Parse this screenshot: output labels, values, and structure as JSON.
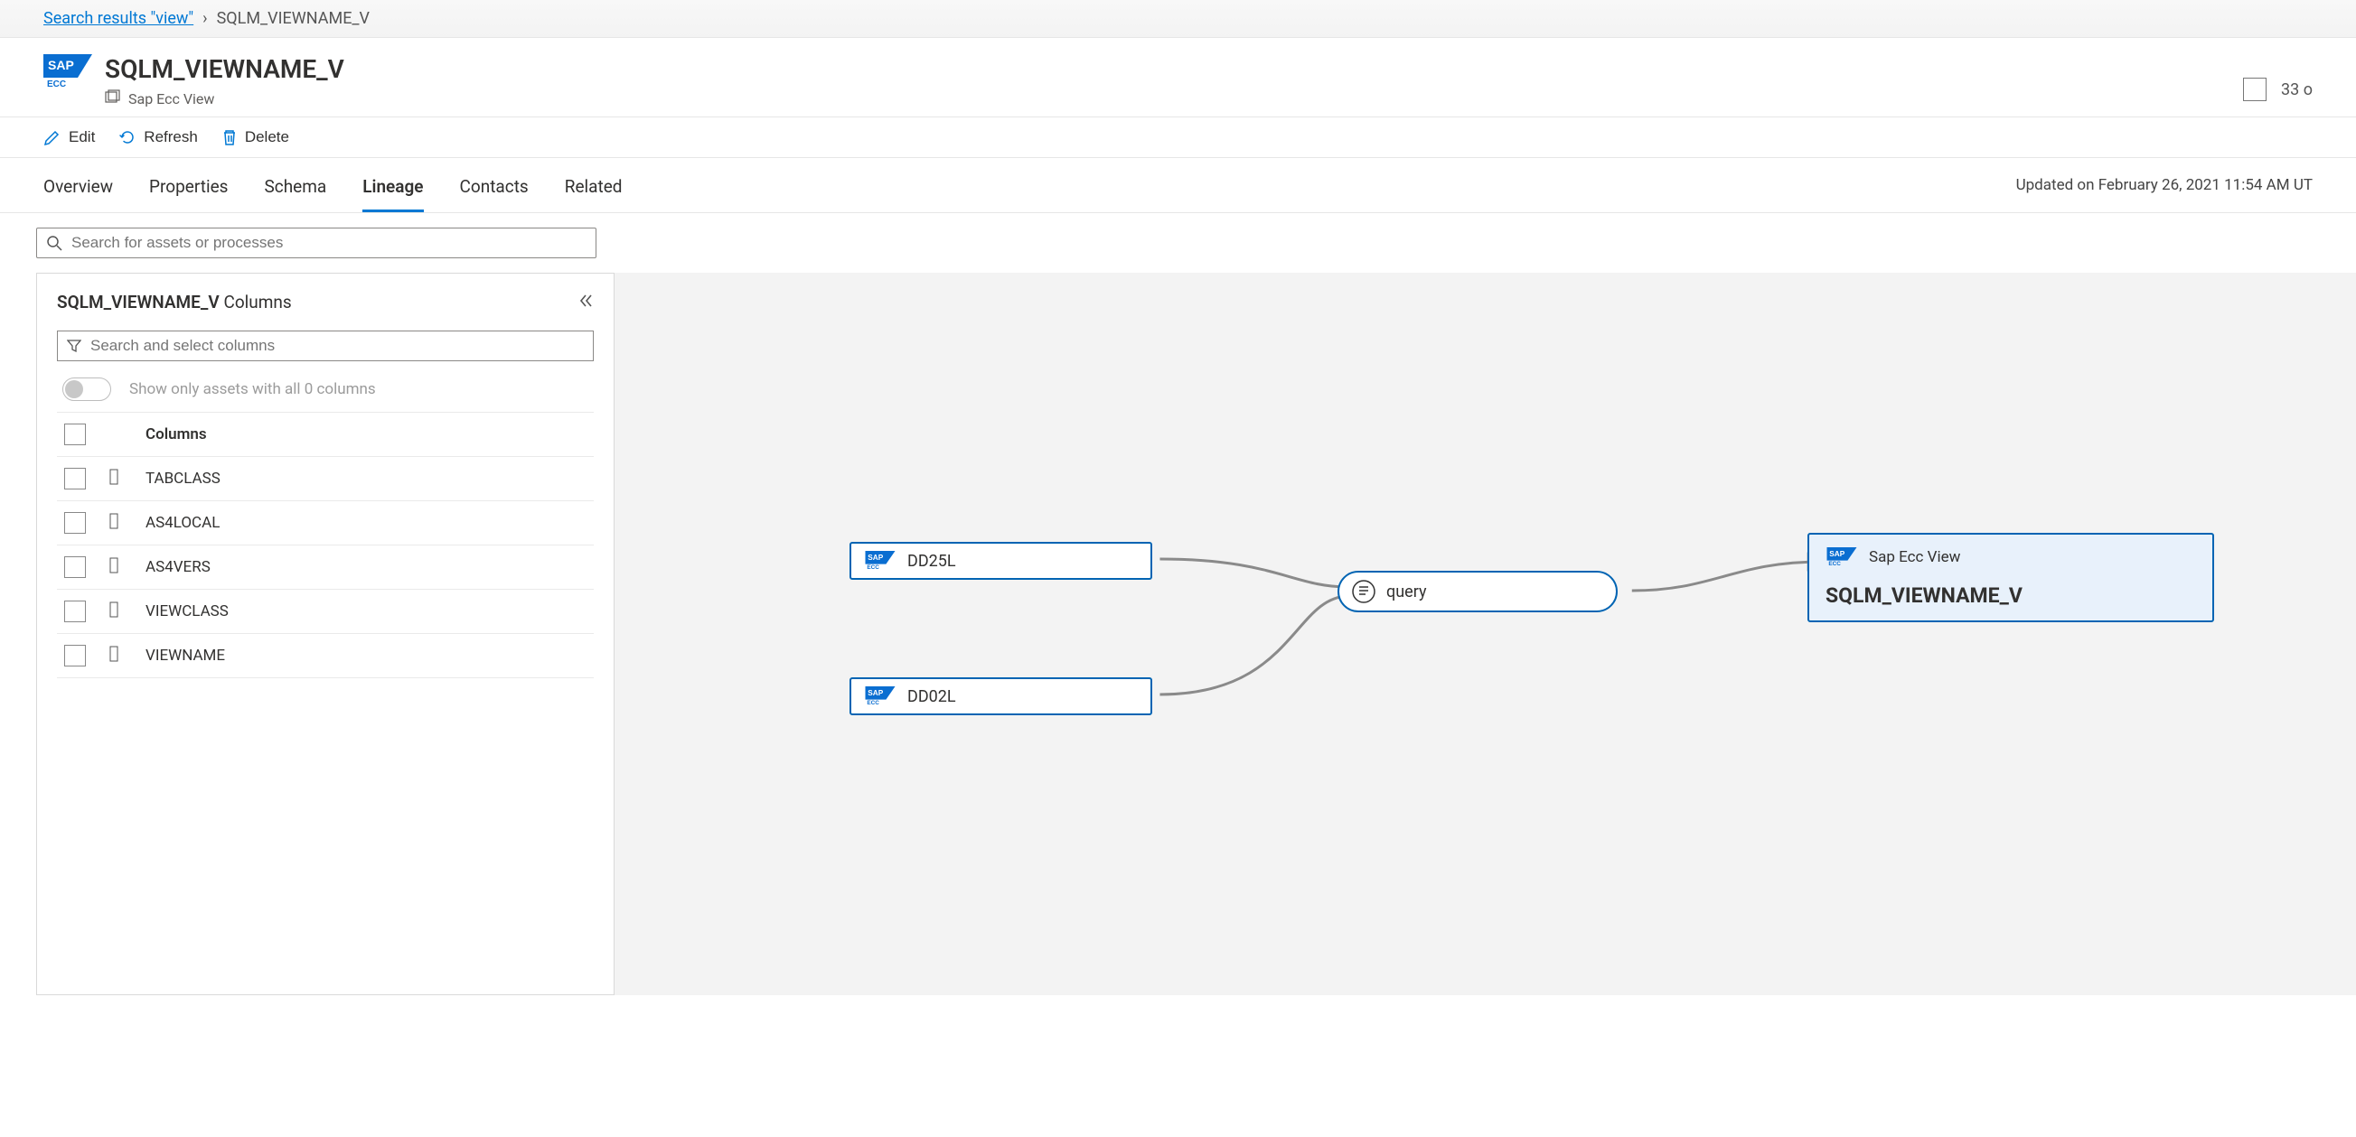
{
  "breadcrumb": {
    "back_label": "Search results \"view\"",
    "current": "SQLM_VIEWNAME_V"
  },
  "header": {
    "title": "SQLM_VIEWNAME_V",
    "subtitle": "Sap Ecc View",
    "right_count": "33 o"
  },
  "toolbar": {
    "edit": "Edit",
    "refresh": "Refresh",
    "delete": "Delete"
  },
  "tabs": {
    "items": [
      {
        "label": "Overview"
      },
      {
        "label": "Properties"
      },
      {
        "label": "Schema"
      },
      {
        "label": "Lineage"
      },
      {
        "label": "Contacts"
      },
      {
        "label": "Related"
      }
    ],
    "active_index": 3
  },
  "updated_text": "Updated on February 26, 2021 11:54 AM UT",
  "asset_search_placeholder": "Search for assets or processes",
  "sidepanel": {
    "title_prefix": "SQLM_VIEWNAME_V",
    "title_suffix": "Columns",
    "filter_placeholder": "Search and select columns",
    "toggle_label": "Show only assets with all 0 columns",
    "header_label": "Columns",
    "columns": [
      {
        "name": "TABCLASS"
      },
      {
        "name": "AS4LOCAL"
      },
      {
        "name": "AS4VERS"
      },
      {
        "name": "VIEWCLASS"
      },
      {
        "name": "VIEWNAME"
      }
    ]
  },
  "lineage": {
    "sources": [
      {
        "label": "DD25L"
      },
      {
        "label": "DD02L"
      }
    ],
    "process": {
      "label": "query"
    },
    "target": {
      "type_label": "Sap Ecc View",
      "name": "SQLM_VIEWNAME_V"
    }
  }
}
